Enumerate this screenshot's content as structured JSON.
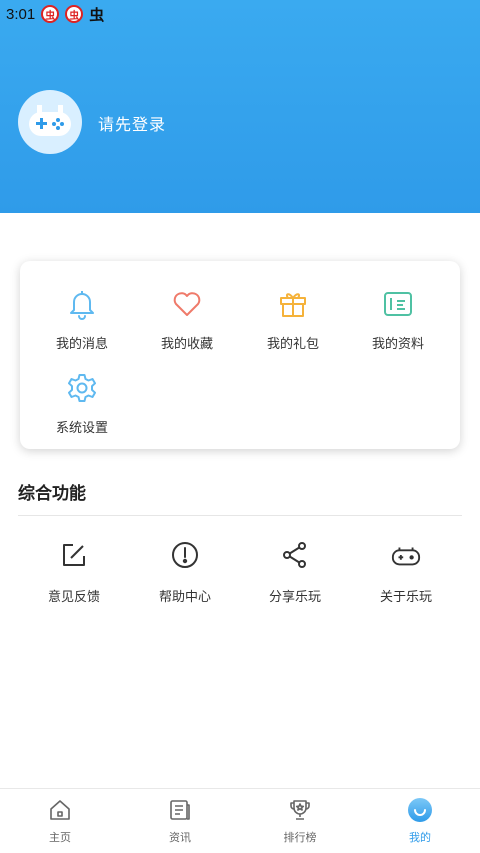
{
  "status_bar": {
    "time": "3:01"
  },
  "header": {
    "login_prompt": "请先登录"
  },
  "quick_menu": {
    "items": [
      {
        "label": "我的消息",
        "icon": "bell-icon"
      },
      {
        "label": "我的收藏",
        "icon": "heart-icon"
      },
      {
        "label": "我的礼包",
        "icon": "gift-icon"
      },
      {
        "label": "我的资料",
        "icon": "profile-card-icon"
      },
      {
        "label": "系统设置",
        "icon": "gear-icon"
      }
    ]
  },
  "functions": {
    "title": "综合功能",
    "items": [
      {
        "label": "意见反馈",
        "icon": "edit-icon"
      },
      {
        "label": "帮助中心",
        "icon": "info-icon"
      },
      {
        "label": "分享乐玩",
        "icon": "share-icon"
      },
      {
        "label": "关于乐玩",
        "icon": "gamepad-icon"
      }
    ]
  },
  "tabbar": {
    "items": [
      {
        "label": "主页",
        "icon": "home-icon"
      },
      {
        "label": "资讯",
        "icon": "news-icon"
      },
      {
        "label": "排行榜",
        "icon": "trophy-icon"
      },
      {
        "label": "我的",
        "icon": "profile-icon"
      }
    ],
    "active_index": 3
  },
  "colors": {
    "header": "#2f9be9",
    "accent": "#2f9be9",
    "bell": "#5fb9f0",
    "heart": "#ef7a6a",
    "gift": "#f5b23a",
    "profile": "#4fc1a3",
    "gear": "#5fb9f0"
  }
}
